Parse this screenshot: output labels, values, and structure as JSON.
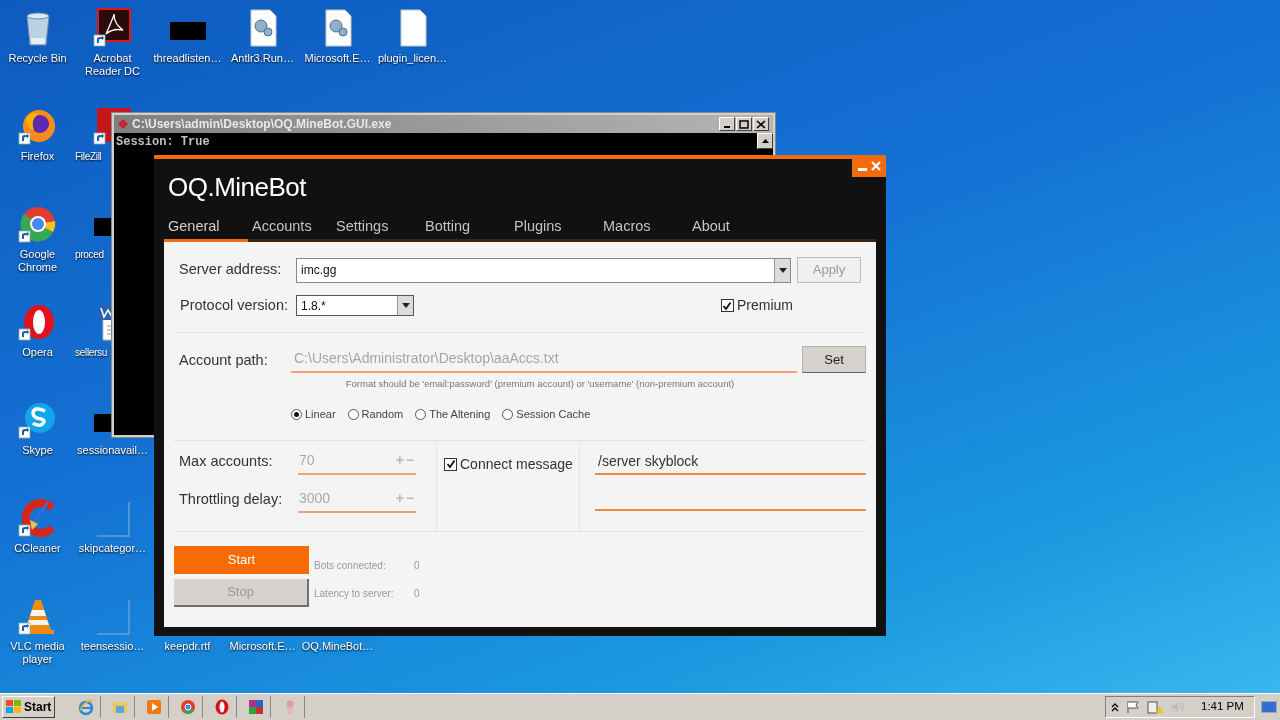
{
  "desktop": {
    "icons": [
      {
        "label": "Recycle Bin",
        "kind": "recycle"
      },
      {
        "label": "Acrobat Reader DC",
        "kind": "pdf"
      },
      {
        "label": "threadlisten…",
        "kind": "black"
      },
      {
        "label": "Antlr3.Run…",
        "kind": "gear-doc"
      },
      {
        "label": "Microsoft.E…",
        "kind": "gear-doc"
      },
      {
        "label": "plugin_licen…",
        "kind": "blank-doc"
      },
      {
        "label": "Firefox",
        "kind": "firefox"
      },
      {
        "label": "FileZill",
        "kind": "filezilla"
      },
      {
        "label": "Google Chrome",
        "kind": "chrome"
      },
      {
        "label": "proced",
        "kind": "black"
      },
      {
        "label": "Opera",
        "kind": "opera"
      },
      {
        "label": "sellersu",
        "kind": "word"
      },
      {
        "label": "Skype",
        "kind": "skype"
      },
      {
        "label": "sessionavail…",
        "kind": "black"
      },
      {
        "label": "CCleaner",
        "kind": "ccleaner"
      },
      {
        "label": "skipcategor…",
        "kind": "outline"
      },
      {
        "label": "VLC media player",
        "kind": "vlc"
      },
      {
        "label": "teensessio…",
        "kind": "outline"
      },
      {
        "label": "keepdr.rtf"
      },
      {
        "label": "Microsoft.E…"
      },
      {
        "label": "OQ.MineBot…"
      }
    ]
  },
  "console_window": {
    "title": "C:\\Users\\admin\\Desktop\\OQ.MineBot.GUI.exe",
    "lines": [
      "Session: True"
    ]
  },
  "app_window": {
    "title": "OQ.MineBot",
    "tabs": [
      {
        "label": "General",
        "selected": true
      },
      {
        "label": "Accounts",
        "selected": false
      },
      {
        "label": "Settings",
        "selected": false
      },
      {
        "label": "Botting",
        "selected": false
      },
      {
        "label": "Plugins",
        "selected": false
      },
      {
        "label": "Macros",
        "selected": false
      },
      {
        "label": "About",
        "selected": false
      }
    ],
    "server_address": {
      "label": "Server address:",
      "value": "imc.gg"
    },
    "apply_button": {
      "label": "Apply",
      "disabled": true
    },
    "protocol_version": {
      "label": "Protocol version:",
      "value": "1.8.*"
    },
    "premium": {
      "label": "Premium",
      "checked": true
    },
    "account_path": {
      "label": "Account path:",
      "value": "C:\\Users\\Administrator\\Desktop\\aaAccs.txt"
    },
    "set_button": {
      "label": "Set",
      "disabled": false
    },
    "format_hint": "Format should be 'email:password' (premium account) or 'username' (non-premium account)",
    "account_modes": [
      {
        "label": "Linear",
        "selected": true
      },
      {
        "label": "Random",
        "selected": false
      },
      {
        "label": "The Altening",
        "selected": false
      },
      {
        "label": "Session Cache",
        "selected": false
      }
    ],
    "numeric_fields": [
      {
        "label": "Max accounts:",
        "value": "70",
        "stepper": [
          "+",
          "−"
        ]
      },
      {
        "label": "Throttling delay:",
        "value": "3000",
        "stepper": [
          "+",
          "−"
        ]
      }
    ],
    "connect_message": {
      "label": "Connect message",
      "checked": true,
      "value": "/server skyblock"
    },
    "start_button": {
      "label": "Start",
      "disabled": false
    },
    "stop_button": {
      "label": "Stop",
      "disabled": true
    },
    "stats": [
      {
        "label": "Bots connected:",
        "value": "0"
      },
      {
        "label": "Latency to server:",
        "value": "0"
      }
    ]
  },
  "taskbar": {
    "start_label": "Start",
    "quick_launch": [
      {
        "kind": "ie"
      },
      {
        "kind": "explorer"
      },
      {
        "kind": "media"
      },
      {
        "kind": "chrome"
      },
      {
        "kind": "opera"
      },
      {
        "kind": "winrar"
      },
      {
        "kind": "app"
      }
    ],
    "clock": "1:41 PM"
  }
}
